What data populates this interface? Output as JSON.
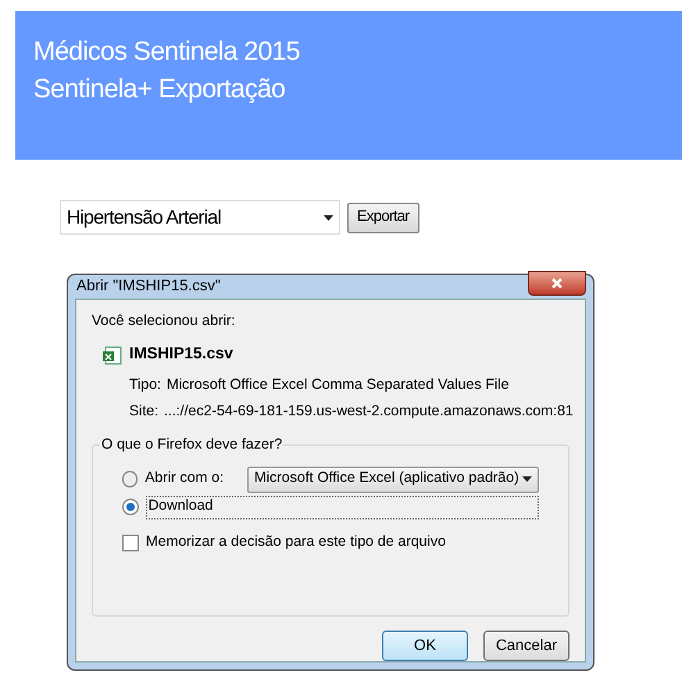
{
  "header": {
    "title": "Médicos Sentinela 2015",
    "subtitle": "Sentinela+ Exportação"
  },
  "export": {
    "select_value": "Hipertensão Arterial",
    "button": "Exportar"
  },
  "dialog": {
    "title": "Abrir \"IMSHIP15.csv\"",
    "intro": "Você selecionou abrir:",
    "file_name": "IMSHIP15.csv",
    "type_label": "Tipo:",
    "type_value": "Microsoft Office Excel Comma Separated Values File",
    "site_label": "Site:",
    "site_value": "...://ec2-54-69-181-159.us-west-2.compute.amazonaws.com:81",
    "group_label": "O que o Firefox deve fazer?",
    "options": [
      {
        "kind": "open_with",
        "label": "Abrir com o:",
        "selected": false,
        "app": "Microsoft Office Excel (aplicativo padrão)"
      },
      {
        "kind": "download",
        "label": "Download",
        "selected": true
      }
    ],
    "remember": {
      "label": "Memorizar a decisão para este tipo de arquivo",
      "checked": false
    },
    "buttons": [
      {
        "label": "OK",
        "default": true
      },
      {
        "label": "Cancelar",
        "default": false
      }
    ]
  }
}
